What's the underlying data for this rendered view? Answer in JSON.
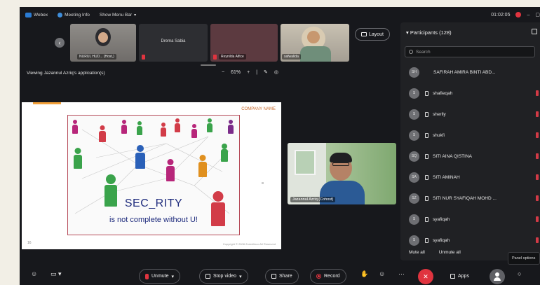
{
  "topbar": {
    "app_name": "Webex",
    "meeting_info": "Meeting Info",
    "show_menu_bar": "Show Menu Bar",
    "timer": "01:02:05",
    "minimize": "–",
    "maximize": "▢"
  },
  "thumbnails": [
    {
      "name": "NURUL HUD... (Host,)"
    },
    {
      "name": "Drema Sabia"
    },
    {
      "name": "Reynilda Alfice"
    },
    {
      "name": "safwalida"
    }
  ],
  "layout_button": "Layout",
  "viewing_label": "Viewing Jazannul Azriq's application(s)",
  "zoom": {
    "minus": "−",
    "value": "61%",
    "plus": "+"
  },
  "slide": {
    "logo": "COMPANY NAME",
    "title": "SEC_RITY",
    "subtitle": "is not complete without U!",
    "page_number": "16",
    "copyright": "Copyright © 2008 Zurichlinco All Reserved"
  },
  "presenter": {
    "name": "Jazannul Azriq (Cohost)"
  },
  "participants": {
    "header": "Participants (128)",
    "search_placeholder": "Search",
    "items": [
      {
        "initials": "SH",
        "name": "SAFIRAH AMIRA BINTI ABD..."
      },
      {
        "initials": "S",
        "name": "shafieqah"
      },
      {
        "initials": "S",
        "name": "sherlly"
      },
      {
        "initials": "S",
        "name": "shukfi"
      },
      {
        "initials": "SQ",
        "name": "SITI AINA QISTINA"
      },
      {
        "initials": "SA",
        "name": "SITI AMINAH"
      },
      {
        "initials": "SZ",
        "name": "SITI NUR SYAFIQAH MOHD ..."
      },
      {
        "initials": "S",
        "name": "syafiqah"
      },
      {
        "initials": "S",
        "name": "syafiqah"
      }
    ],
    "mute_all": "Mute all",
    "unmute_all": "Unmute all",
    "tooltip": "Panel options"
  },
  "toolbar": {
    "unmute": "Unmute",
    "stop_video": "Stop video",
    "share": "Share",
    "record": "Record",
    "apps": "Apps",
    "more": "···"
  }
}
